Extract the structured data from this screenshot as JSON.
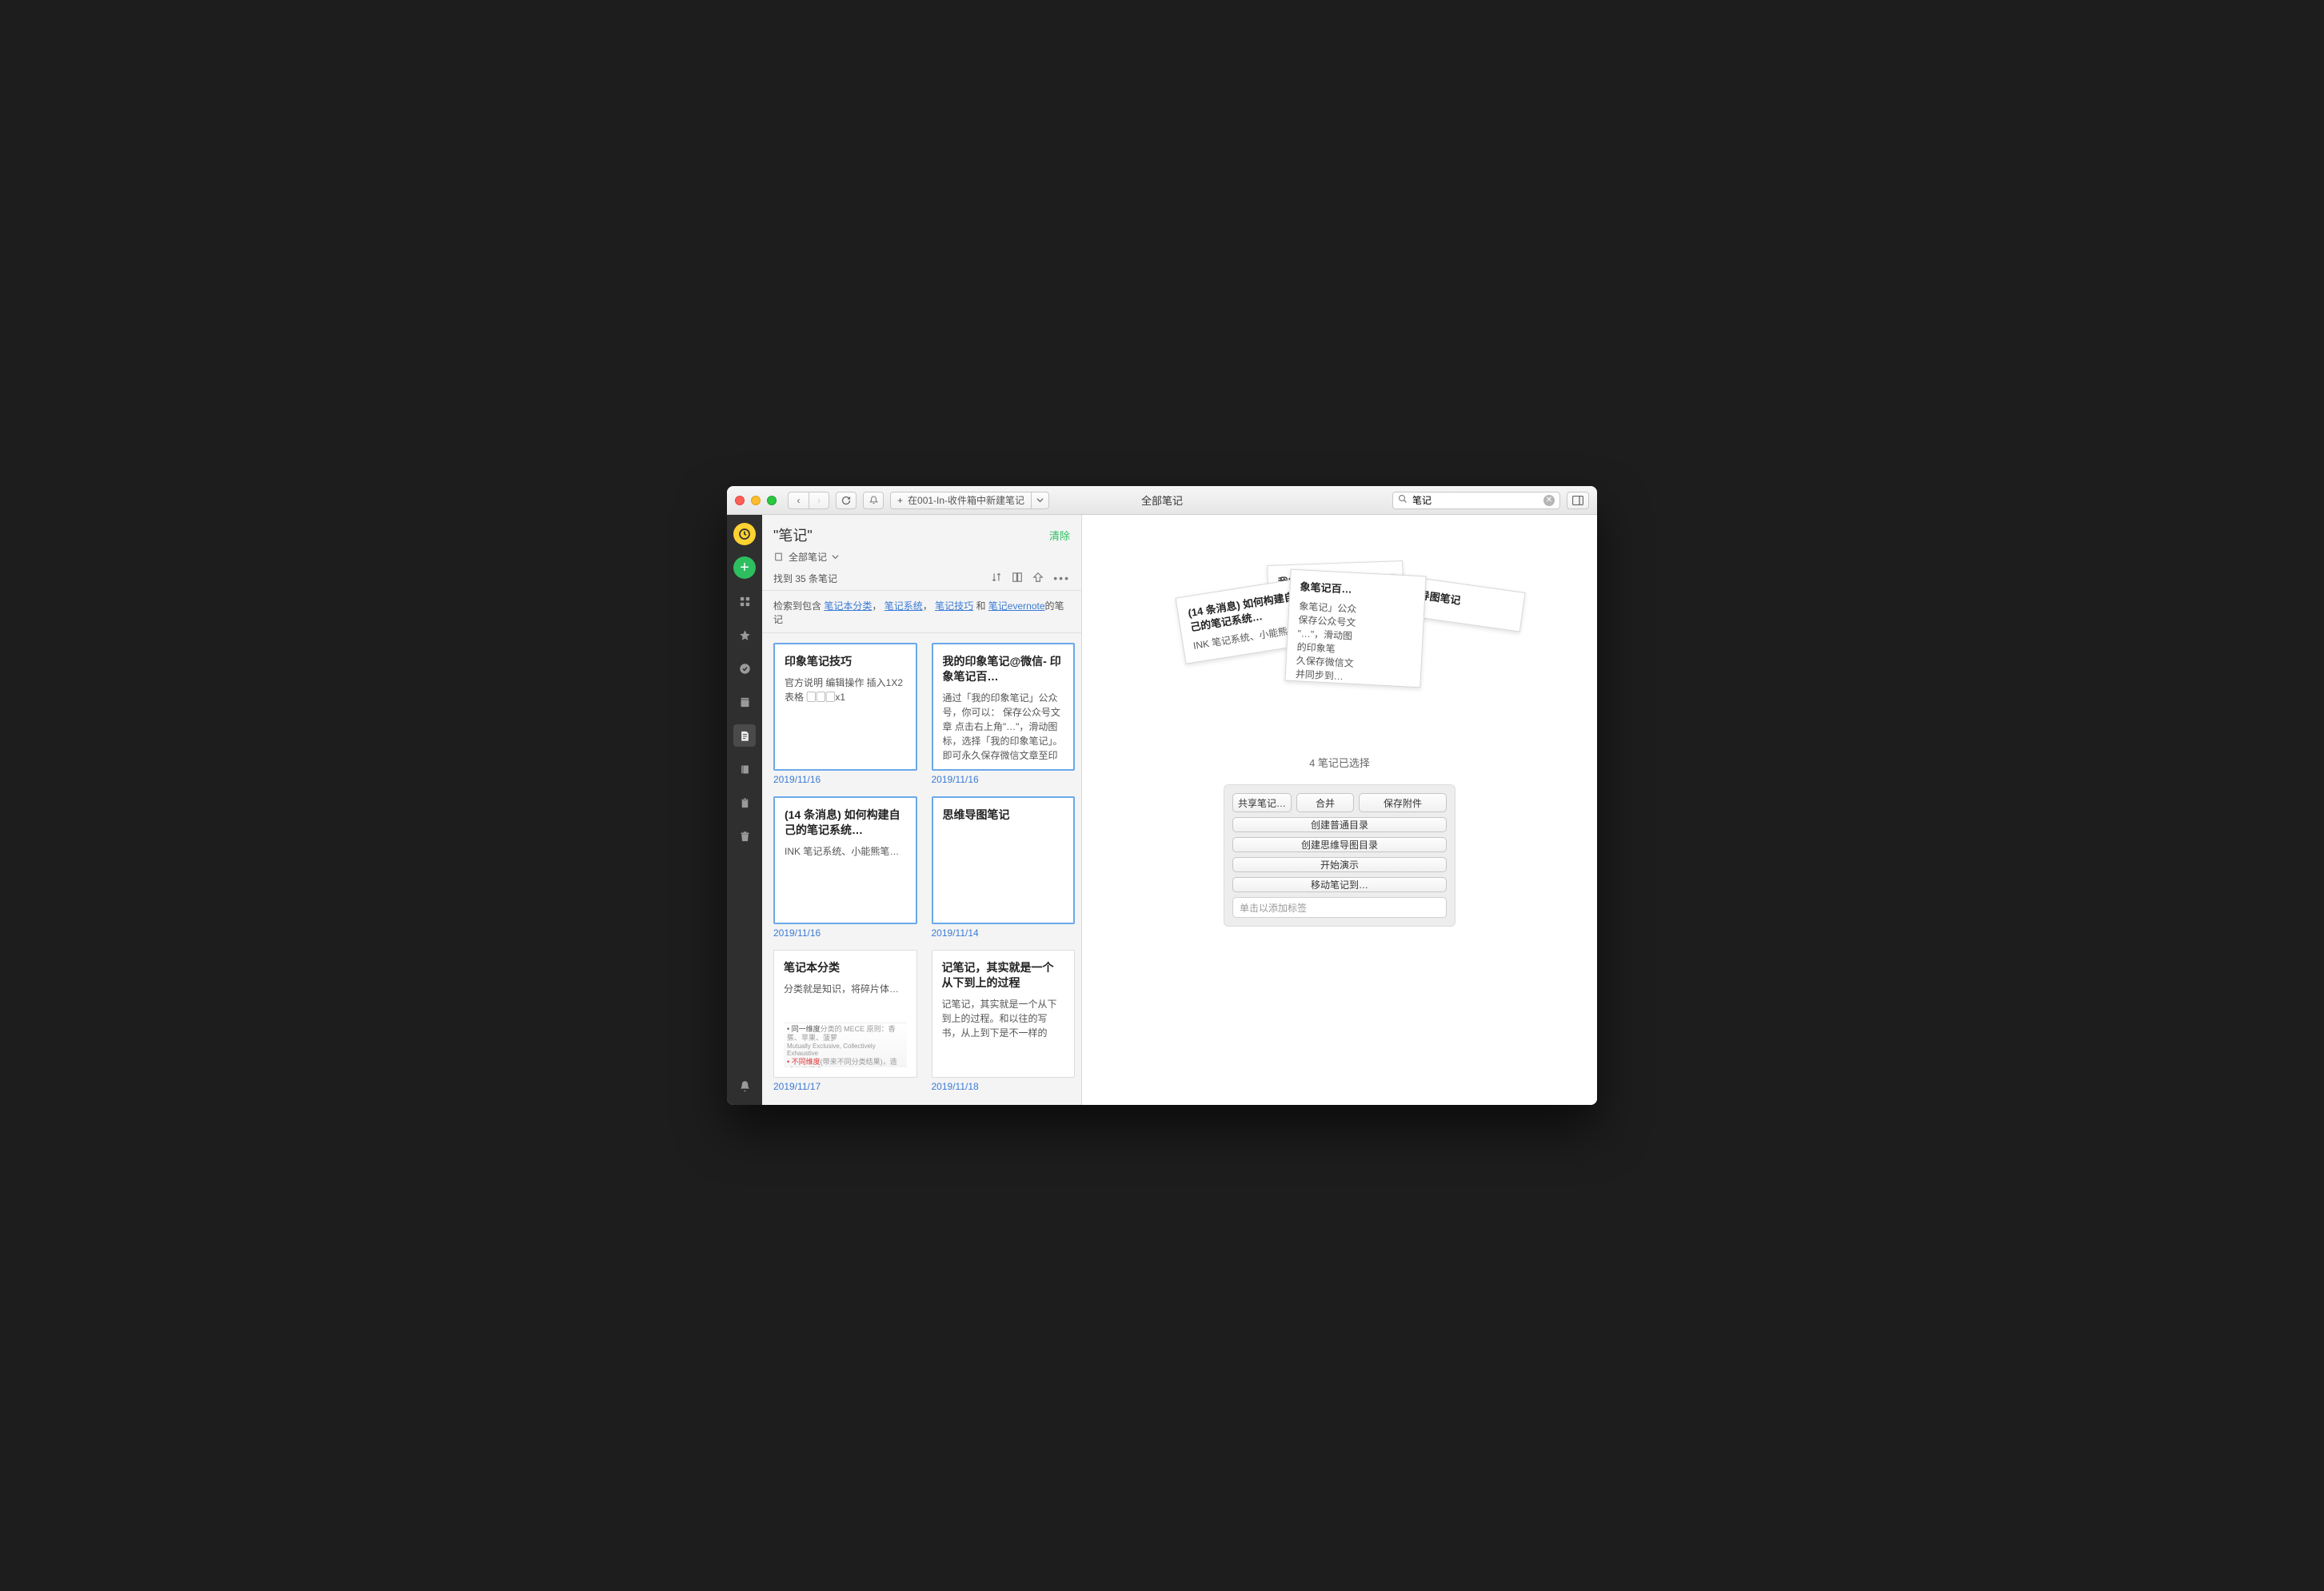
{
  "titlebar": {
    "new_note_label": "在001-In-收件箱中新建笔记",
    "window_title": "全部笔记",
    "search_value": "笔记"
  },
  "listpanel": {
    "title_prefix": "\"",
    "title_text": "笔记",
    "title_suffix": "\"",
    "clear": "清除",
    "scope": "全部笔记",
    "count_text": "找到 35 条笔记",
    "suggest_prefix": "检索到包含",
    "suggest_links": [
      "笔记本分类",
      "笔记系统",
      "笔记技巧"
    ],
    "suggest_joiner": "，",
    "suggest_and": " 和 ",
    "suggest_last_link": "笔记evernote",
    "suggest_suffix": "的笔记"
  },
  "cards": [
    {
      "title": "印象笔记技巧",
      "body": "官方说明 编辑操作 插入1X2 表格 ▢▢▢x1",
      "date": "2019/11/16",
      "selected": true
    },
    {
      "title": "我的印象笔记@微信- 印象笔记百…",
      "body": "通过「我的印象笔记」公众号，你可以： 保存公众号文章 点击右上角\"…\"，滑动图标，选择「我的印象笔记」。即可永久保存微信文章至印象笔记，并同步到…",
      "date": "2019/11/16",
      "selected": true
    },
    {
      "title": "(14 条消息) 如何构建自己的笔记系统…",
      "body": "INK 笔记系统、小能熊笔…",
      "date": "2019/11/16",
      "selected": true
    },
    {
      "title": "思维导图笔记",
      "body": "",
      "date": "2019/11/14",
      "selected": true
    },
    {
      "title": "笔记本分类",
      "body": "分类就是知识，将碎片体…",
      "date": "2019/11/17",
      "selected": false,
      "thumb": true
    },
    {
      "title": "记笔记，其实就是一个从下到上的过程",
      "body": "记笔记，其实就是一个从下到上的过程。和以往的写书，从上到下是不一样的",
      "date": "2019/11/18",
      "selected": false
    }
  ],
  "detail": {
    "stack_titles": {
      "hidden": "我的印象笔记@",
      "p1_title": "(14 条消息) 如何构建自己的笔记系统…",
      "p1_body": "INK 笔记系统、小能熊笔…",
      "p2_title": "象笔记百…",
      "p2_body": "象笔记」公众\n保存公众号文\n\"…\"，滑动图\n的印象笔\n久保存微信文\n并同步到…",
      "p3_title": "思维导图笔记"
    },
    "selected_text": "4 笔记已选择",
    "actions": {
      "share": "共享笔记…",
      "merge": "合并",
      "save_attach": "保存附件",
      "create_toc": "创建普通目录",
      "create_mindmap_toc": "创建思维导图目录",
      "start_present": "开始演示",
      "move_to": "移动笔记到…",
      "tag_placeholder": "单击以添加标签"
    }
  }
}
